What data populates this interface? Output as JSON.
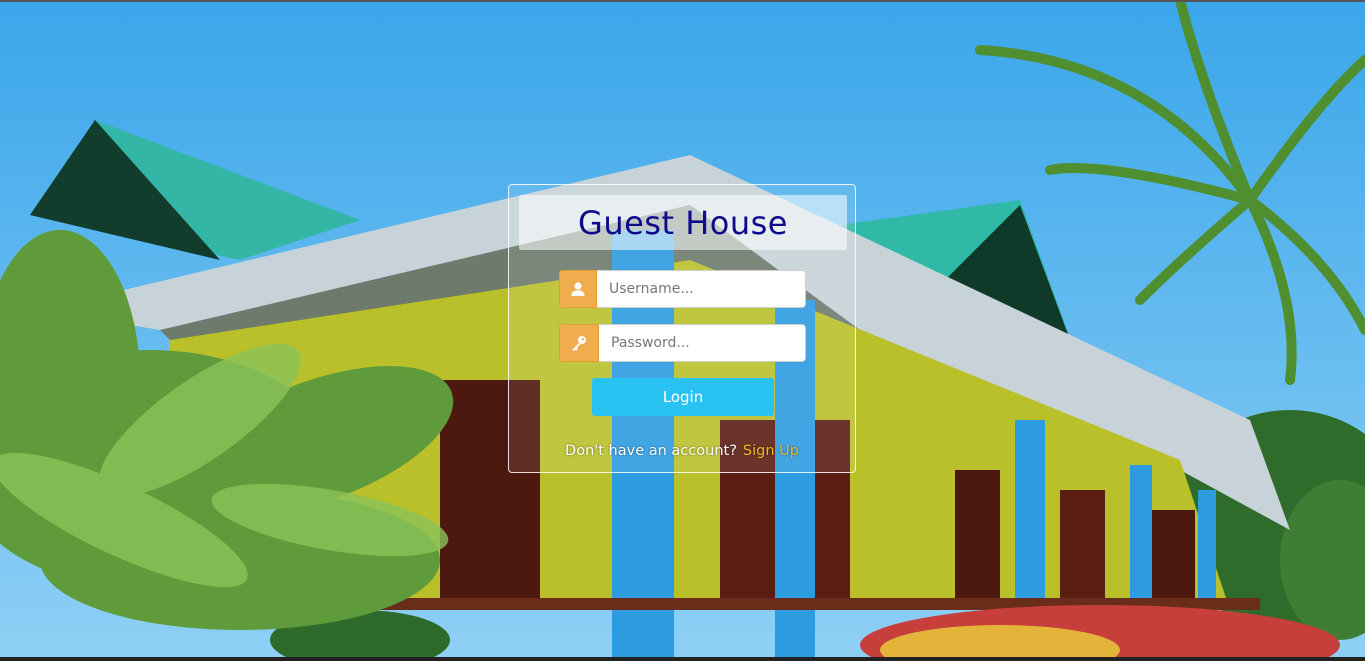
{
  "app": {
    "title": "Guest House"
  },
  "form": {
    "username_placeholder": "Username...",
    "password_placeholder": "Password...",
    "username_value": "",
    "password_value": "",
    "login_label": "Login",
    "signup_prompt": "Don't have an account?",
    "signup_link": "Sign Up"
  },
  "icons": {
    "username": "user-icon",
    "password": "key-icon"
  },
  "colors": {
    "title": "#0b0b8c",
    "addon": "#f0ad4e",
    "login_button": "#29c3f3",
    "signup_link": "#f5b41e"
  }
}
